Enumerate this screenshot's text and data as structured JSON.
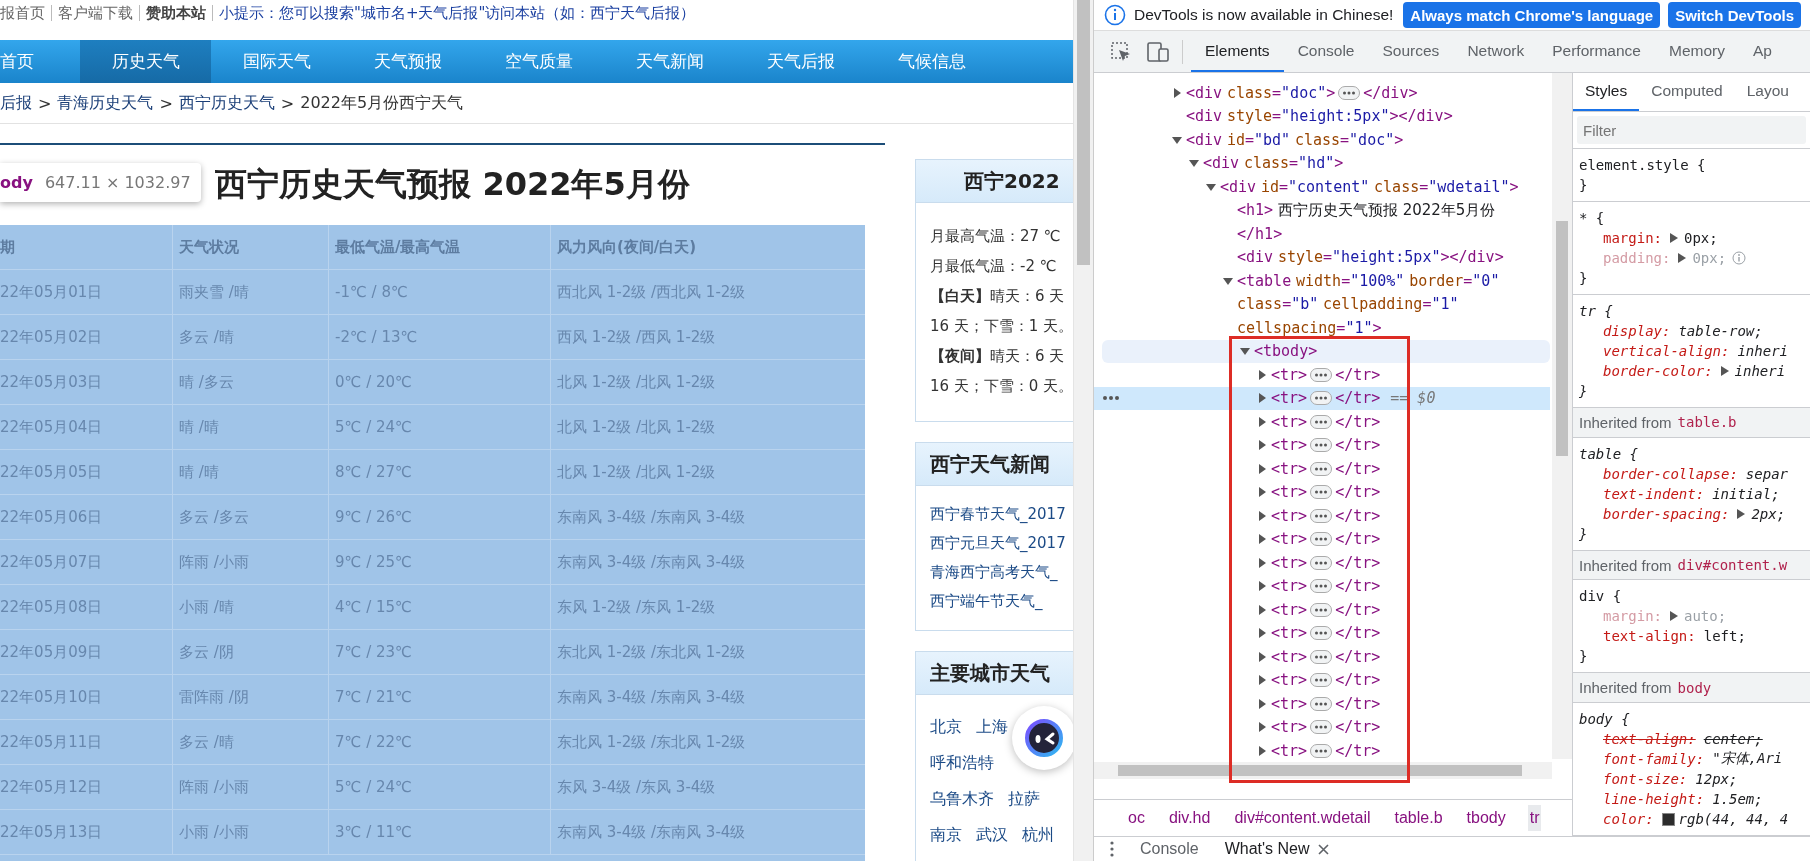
{
  "page": {
    "top_links": [
      {
        "label": "报首页",
        "kind": "link"
      },
      {
        "label": "客户端下载",
        "kind": "link"
      },
      {
        "label": "赞助本站",
        "kind": "bold"
      },
      {
        "label": "小提示：您可以搜索\"城市名+天气后报\"访问本站（如：西宁天气后报）",
        "kind": "tip"
      }
    ],
    "nav": [
      {
        "label": "首页",
        "selected": false
      },
      {
        "label": "历史天气",
        "selected": true
      },
      {
        "label": "国际天气",
        "selected": false
      },
      {
        "label": "天气预报",
        "selected": false
      },
      {
        "label": "空气质量",
        "selected": false
      },
      {
        "label": "天气新闻",
        "selected": false
      },
      {
        "label": "天气后报",
        "selected": false
      },
      {
        "label": "气候信息",
        "selected": false
      }
    ],
    "breadcrumb": [
      {
        "label": "后报",
        "kind": "link"
      },
      {
        "label": ">",
        "kind": "separator"
      },
      {
        "label": "青海历史天气",
        "kind": "link"
      },
      {
        "label": ">",
        "kind": "separator"
      },
      {
        "label": "西宁历史天气",
        "kind": "link"
      },
      {
        "label": ">",
        "kind": "separator"
      },
      {
        "label": "2022年5月份西宁天气",
        "kind": "current"
      }
    ],
    "title": "西宁历史天气预报 2022年5月份",
    "inspect_tooltip": {
      "tag": "ody",
      "size": "647.11 × 1032.97"
    },
    "table": {
      "columns": [
        "期",
        "天气状况",
        "最低气温/最高气温",
        "风力风向(夜间/白天)"
      ],
      "rows": [
        [
          "22年05月01日",
          "雨夹雪 /晴",
          "-1℃ / 8℃",
          "西北风 1-2级 /西北风 1-2级"
        ],
        [
          "22年05月02日",
          "多云 /晴",
          "-2℃ / 13℃",
          "西风 1-2级 /西风 1-2级"
        ],
        [
          "22年05月03日",
          "晴 /多云",
          "0℃ / 20℃",
          "北风 1-2级 /北风 1-2级"
        ],
        [
          "22年05月04日",
          "晴 /晴",
          "5℃ / 24℃",
          "北风 1-2级 /北风 1-2级"
        ],
        [
          "22年05月05日",
          "晴 /晴",
          "8℃ / 27℃",
          "北风 1-2级 /北风 1-2级"
        ],
        [
          "22年05月06日",
          "多云 /多云",
          "9℃ / 26℃",
          "东南风 3-4级 /东南风 3-4级"
        ],
        [
          "22年05月07日",
          "阵雨 /小雨",
          "9℃ / 25℃",
          "东南风 3-4级 /东南风 3-4级"
        ],
        [
          "22年05月08日",
          "小雨 /晴",
          "4℃ / 15℃",
          "东风 1-2级 /东风 1-2级"
        ],
        [
          "22年05月09日",
          "多云 /阴",
          "7℃ / 23℃",
          "东北风 1-2级 /东北风 1-2级"
        ],
        [
          "22年05月10日",
          "雷阵雨 /阴",
          "7℃ / 21℃",
          "东南风 3-4级 /东南风 3-4级"
        ],
        [
          "22年05月11日",
          "多云 /晴",
          "7℃ / 22℃",
          "东北风 1-2级 /东北风 1-2级"
        ],
        [
          "22年05月12日",
          "阵雨 /小雨",
          "5℃ / 24℃",
          "东风 3-4级 /东风 3-4级"
        ],
        [
          "22年05月13日",
          "小雨 /小雨",
          "3℃ / 11℃",
          "东南风 3-4级 /东南风 3-4级"
        ]
      ]
    },
    "sidebar": [
      {
        "kind": "summary",
        "title": "西宁2022",
        "lines": [
          "月最高气温：27 ℃",
          "月最低气温：-2 ℃",
          "**【白天】**晴天：6 天",
          "16 天；下雪：1 天。",
          "**【夜间】**晴天：6 天",
          "16 天；下雪：0 天。"
        ]
      },
      {
        "kind": "links",
        "title": "西宁天气新闻",
        "lines": [
          "西宁春节天气_2017",
          "西宁元旦天气_2017",
          "青海西宁高考天气_",
          "西宁端午节天气_"
        ]
      },
      {
        "kind": "cities",
        "title": "主要城市天气",
        "rows": [
          [
            "北京",
            "上海"
          ],
          [
            "呼和浩特"
          ],
          [
            "乌鲁木齐",
            "拉萨"
          ],
          [
            "南京",
            "武汉",
            "杭州"
          ]
        ]
      }
    ]
  },
  "devtools": {
    "infobar": {
      "message": "DevTools is now available in Chinese!",
      "buttons": [
        "Always match Chrome's language",
        "Switch DevTools"
      ]
    },
    "tabs": [
      {
        "label": "Elements",
        "selected": true
      },
      {
        "label": "Console",
        "selected": false
      },
      {
        "label": "Sources",
        "selected": false
      },
      {
        "label": "Network",
        "selected": false
      },
      {
        "label": "Performance",
        "selected": false
      },
      {
        "label": "Memory",
        "selected": false
      },
      {
        "label": "Ap",
        "selected": false
      }
    ],
    "elements_panel": {
      "nodes": [
        {
          "lines": [
            "<div class=\"doc\">"
          ],
          "closing": "</div>",
          "expanded": false,
          "selected": false,
          "hovered": false
        },
        {
          "lines": [
            "<div style=\"height:5px\"></div>"
          ],
          "selected": false,
          "hovered": false
        },
        {
          "lines": [
            "<div id=\"bd\" class=\"doc\">"
          ],
          "expanded": true,
          "selected": false,
          "hovered": false,
          "children": [
            {
              "lines": [
                "<div class=\"hd\">"
              ],
              "expanded": true,
              "selected": false,
              "hovered": false,
              "children": [
                {
                  "lines": [
                    "<div id=\"content\" class=\"wdetail\">"
                  ],
                  "expanded": true,
                  "selected": false,
                  "hovered": false,
                  "children": [
                    {
                      "lines": [
                        "<h1> 西宁历史天气预报 2022年5月份",
                        "</h1>"
                      ],
                      "selected": false,
                      "hovered": false
                    },
                    {
                      "lines": [
                        "<div style=\"height:5px\"></div>"
                      ],
                      "selected": false,
                      "hovered": false
                    },
                    {
                      "lines": [
                        "<table width=\"100%\" border=\"0\"",
                        "class=\"b\" cellpadding=\"1\"",
                        "cellspacing=\"1\">"
                      ],
                      "expanded": true,
                      "selected": false,
                      "hovered": false,
                      "children": [
                        {
                          "lines": [
                            "<tbody>"
                          ],
                          "expanded": true,
                          "selected": false,
                          "hovered": true,
                          "children": [
                            {
                              "lines": [
                                "<tr>"
                              ],
                              "closing": "</tr>",
                              "expanded": false,
                              "selected": false,
                              "hovered": false
                            },
                            {
                              "lines": [
                                "<tr>"
                              ],
                              "closing": "</tr>",
                              "suffix": "== $0",
                              "expanded": false,
                              "selected": true,
                              "hovered": false
                            },
                            {
                              "lines": [
                                "<tr>"
                              ],
                              "closing": "</tr>",
                              "expanded": false,
                              "selected": false,
                              "hovered": false
                            },
                            {
                              "lines": [
                                "<tr>"
                              ],
                              "closing": "</tr>",
                              "expanded": false,
                              "selected": false,
                              "hovered": false
                            },
                            {
                              "lines": [
                                "<tr>"
                              ],
                              "closing": "</tr>",
                              "expanded": false,
                              "selected": false,
                              "hovered": false
                            },
                            {
                              "lines": [
                                "<tr>"
                              ],
                              "closing": "</tr>",
                              "expanded": false,
                              "selected": false,
                              "hovered": false
                            },
                            {
                              "lines": [
                                "<tr>"
                              ],
                              "closing": "</tr>",
                              "expanded": false,
                              "selected": false,
                              "hovered": false
                            },
                            {
                              "lines": [
                                "<tr>"
                              ],
                              "closing": "</tr>",
                              "expanded": false,
                              "selected": false,
                              "hovered": false
                            },
                            {
                              "lines": [
                                "<tr>"
                              ],
                              "closing": "</tr>",
                              "expanded": false,
                              "selected": false,
                              "hovered": false
                            },
                            {
                              "lines": [
                                "<tr>"
                              ],
                              "closing": "</tr>",
                              "expanded": false,
                              "selected": false,
                              "hovered": false
                            },
                            {
                              "lines": [
                                "<tr>"
                              ],
                              "closing": "</tr>",
                              "expanded": false,
                              "selected": false,
                              "hovered": false
                            },
                            {
                              "lines": [
                                "<tr>"
                              ],
                              "closing": "</tr>",
                              "expanded": false,
                              "selected": false,
                              "hovered": false
                            },
                            {
                              "lines": [
                                "<tr>"
                              ],
                              "closing": "</tr>",
                              "expanded": false,
                              "selected": false,
                              "hovered": false
                            },
                            {
                              "lines": [
                                "<tr>"
                              ],
                              "closing": "</tr>",
                              "expanded": false,
                              "selected": false,
                              "hovered": false
                            },
                            {
                              "lines": [
                                "<tr>"
                              ],
                              "closing": "</tr>",
                              "expanded": false,
                              "selected": false,
                              "hovered": false
                            },
                            {
                              "lines": [
                                "<tr>"
                              ],
                              "closing": "</tr>",
                              "expanded": false,
                              "selected": false,
                              "hovered": false
                            },
                            {
                              "lines": [
                                "<tr>"
                              ],
                              "closing": "</tr>",
                              "expanded": false,
                              "selected": false,
                              "hovered": false
                            }
                          ]
                        }
                      ]
                    }
                  ]
                }
              ]
            }
          ]
        }
      ]
    },
    "breadcrumbs": [
      {
        "label": "oc",
        "selected": false
      },
      {
        "label": "div.hd",
        "selected": false
      },
      {
        "label": "div#content.wdetail",
        "selected": false
      },
      {
        "label": "table.b",
        "selected": false
      },
      {
        "label": "tbody",
        "selected": false
      },
      {
        "label": "tr",
        "selected": true
      }
    ],
    "drawer_tabs": [
      {
        "label": "Console",
        "selected": false,
        "closable": false
      },
      {
        "label": "What's New",
        "selected": true,
        "closable": true
      }
    ],
    "styles_pane": {
      "tabs": [
        {
          "label": "Styles",
          "selected": true
        },
        {
          "label": "Computed",
          "selected": false
        },
        {
          "label": "Layou",
          "selected": false
        }
      ],
      "filter": {
        "placeholder": "Filter"
      },
      "sections": [
        {
          "kind": "rule",
          "selector": "element.style {",
          "close": "}",
          "user_agent": false
        },
        {
          "kind": "rule",
          "selector": "* {",
          "close": "}",
          "user_agent": false,
          "declarations": [
            {
              "property": "margin:",
              "value": "0px;",
              "expandable": true,
              "inactive": false,
              "overridden": false,
              "hint": false
            },
            {
              "property": "padding:",
              "value": "0px;",
              "expandable": true,
              "inactive": true,
              "overridden": false,
              "hint": true
            }
          ]
        },
        {
          "kind": "rule",
          "selector": "tr {",
          "close": "}",
          "user_agent": true,
          "declarations": [
            {
              "property": "display:",
              "value": "table-row;",
              "expandable": false,
              "inactive": false,
              "overridden": false,
              "hint": false
            },
            {
              "property": "vertical-align:",
              "value": "inheri",
              "expandable": false,
              "inactive": false,
              "overridden": false,
              "hint": false
            },
            {
              "property": "border-color:",
              "value": "inheri",
              "expandable": true,
              "inactive": false,
              "overridden": false,
              "hint": false
            }
          ]
        },
        {
          "kind": "inherited",
          "label": "Inherited from",
          "source": "table.b"
        },
        {
          "kind": "rule",
          "selector": "table {",
          "close": "}",
          "user_agent": true,
          "declarations": [
            {
              "property": "border-collapse:",
              "value": "separ",
              "expandable": false,
              "inactive": false,
              "overridden": false,
              "hint": false
            },
            {
              "property": "text-indent:",
              "value": "initial;",
              "expandable": false,
              "inactive": false,
              "overridden": false,
              "hint": false
            },
            {
              "property": "border-spacing:",
              "value": "2px;",
              "expandable": true,
              "inactive": false,
              "overridden": false,
              "hint": false
            }
          ]
        },
        {
          "kind": "inherited",
          "label": "Inherited from",
          "source": "div#content.w"
        },
        {
          "kind": "rule",
          "selector": "div {",
          "close": "}",
          "user_agent": false,
          "declarations": [
            {
              "property": "margin:",
              "value": "auto;",
              "expandable": true,
              "inactive": true,
              "overridden": false,
              "hint": false
            },
            {
              "property": "text-align:",
              "value": "left;",
              "expandable": false,
              "inactive": false,
              "overridden": false,
              "hint": false
            }
          ]
        },
        {
          "kind": "inherited",
          "label": "Inherited from",
          "source": "body"
        },
        {
          "kind": "rule",
          "selector": "body {",
          "user_agent": true,
          "declarations": [
            {
              "property": "text-align:",
              "value": "center;",
              "expandable": false,
              "inactive": false,
              "overridden": true,
              "hint": false
            },
            {
              "property": "font-family:",
              "value": "\"宋体,Ari",
              "expandable": false,
              "inactive": false,
              "overridden": false,
              "hint": false
            },
            {
              "property": "font-size:",
              "value": "12px;",
              "expandable": false,
              "inactive": false,
              "overridden": false,
              "hint": false
            },
            {
              "property": "line-height:",
              "value": "1.5em;",
              "expandable": false,
              "inactive": false,
              "overridden": false,
              "hint": false
            },
            {
              "property": "color:",
              "value": "rgb(44, 44, 4",
              "color": "#2c2c2c",
              "expandable": false,
              "inactive": false,
              "overridden": false,
              "hint": false
            }
          ]
        }
      ]
    }
  }
}
